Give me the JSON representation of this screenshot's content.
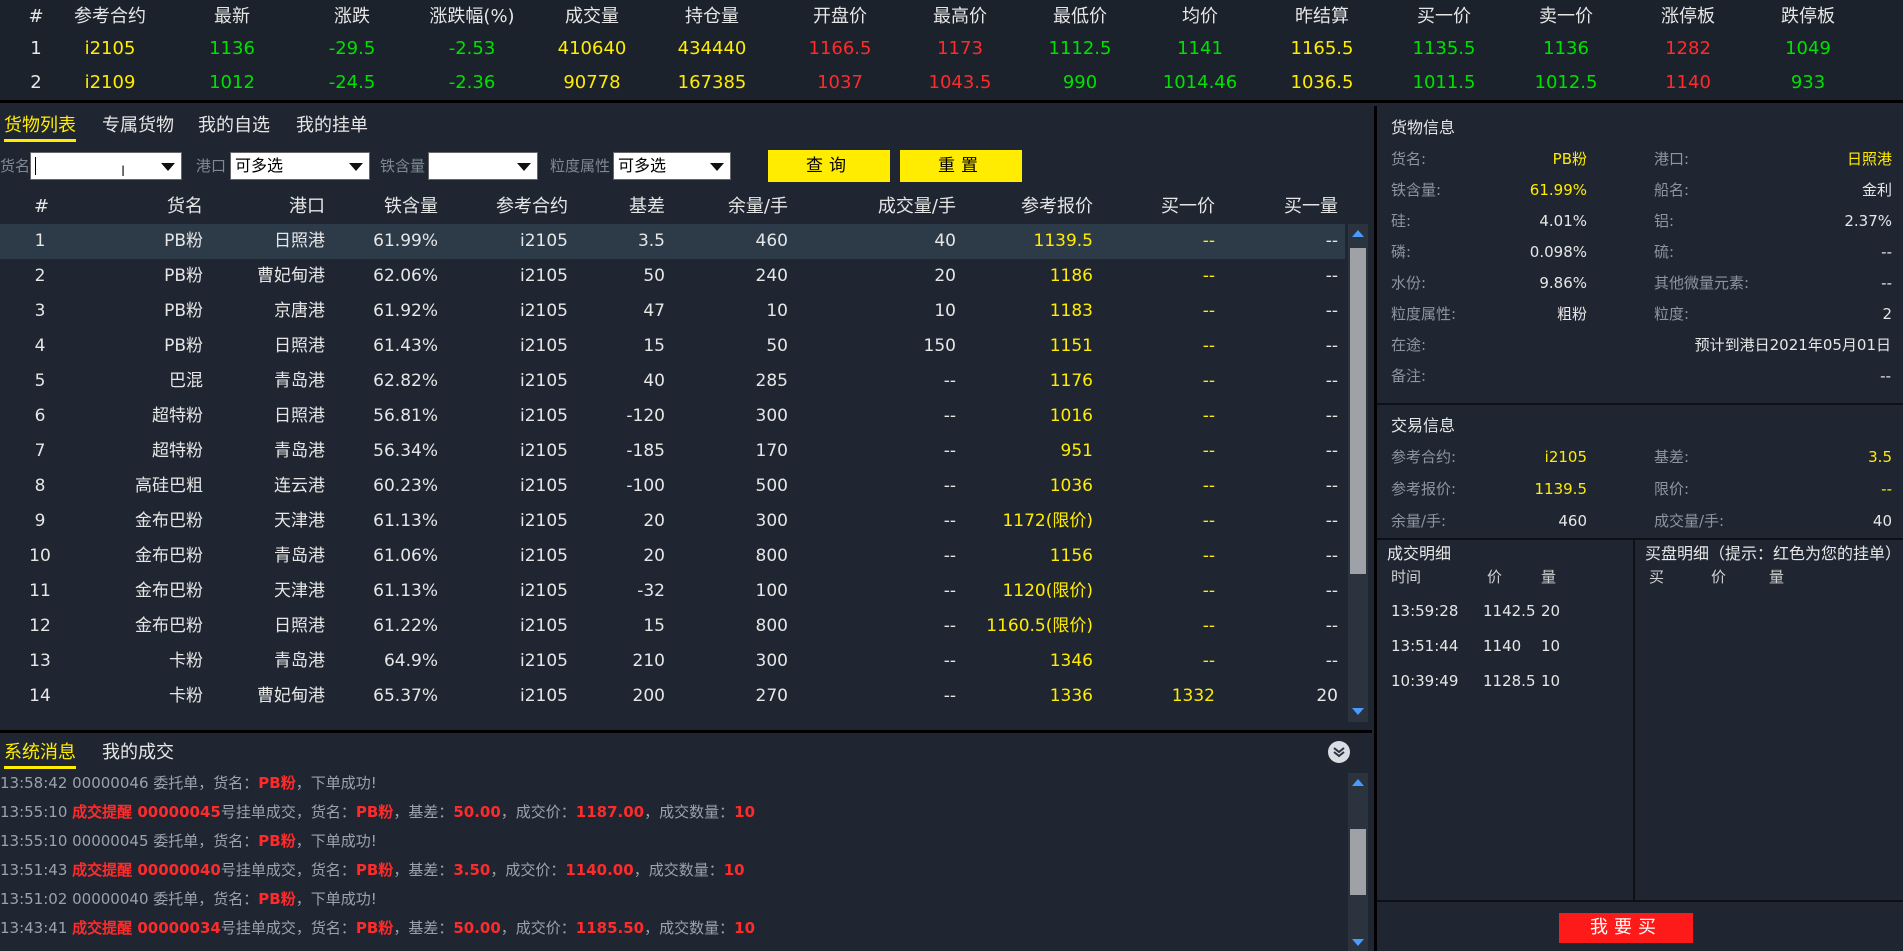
{
  "quotes": {
    "headers": [
      "#",
      "参考合约",
      "最新",
      "涨跌",
      "涨跌幅(%)",
      "成交量",
      "持仓量",
      "开盘价",
      "最高价",
      "最低价",
      "均价",
      "昨结算",
      "买一价",
      "卖一价",
      "涨停板",
      "跌停板"
    ],
    "rows": [
      [
        "1",
        "i2105",
        "1136",
        "-29.5",
        "-2.53",
        "410640",
        "434440",
        "1166.5",
        "1173",
        "1112.5",
        "1141",
        "1165.5",
        "1135.5",
        "1136",
        "1282",
        "1049"
      ],
      [
        "2",
        "i2109",
        "1012",
        "-24.5",
        "-2.36",
        "90778",
        "167385",
        "1037",
        "1043.5",
        "990",
        "1014.46",
        "1036.5",
        "1011.5",
        "1012.5",
        "1140",
        "933"
      ]
    ]
  },
  "main_tabs": [
    "货物列表",
    "专属货物",
    "我的自选",
    "我的挂单"
  ],
  "filters": {
    "name_label": "货名",
    "name_value": "",
    "port_label": "港口",
    "port_value": "可多选",
    "iron_label": "铁含量",
    "iron_value": "",
    "size_label": "粒度属性",
    "size_value": "可多选",
    "query_btn": "查询",
    "reset_btn": "重置"
  },
  "goods": {
    "headers": [
      "#",
      "货名",
      "港口",
      "铁含量",
      "参考合约",
      "基差",
      "余量/手",
      "成交量/手",
      "参考报价",
      "买一价",
      "买一量"
    ],
    "rows": [
      [
        "1",
        "PB粉",
        "日照港",
        "61.99%",
        "i2105",
        "3.5",
        "460",
        "40",
        "1139.5",
        "--",
        "--"
      ],
      [
        "2",
        "PB粉",
        "曹妃甸港",
        "62.06%",
        "i2105",
        "50",
        "240",
        "20",
        "1186",
        "--",
        "--"
      ],
      [
        "3",
        "PB粉",
        "京唐港",
        "61.92%",
        "i2105",
        "47",
        "10",
        "10",
        "1183",
        "--",
        "--"
      ],
      [
        "4",
        "PB粉",
        "日照港",
        "61.43%",
        "i2105",
        "15",
        "50",
        "150",
        "1151",
        "--",
        "--"
      ],
      [
        "5",
        "巴混",
        "青岛港",
        "62.82%",
        "i2105",
        "40",
        "285",
        "--",
        "1176",
        "--",
        "--"
      ],
      [
        "6",
        "超特粉",
        "日照港",
        "56.81%",
        "i2105",
        "-120",
        "300",
        "--",
        "1016",
        "--",
        "--"
      ],
      [
        "7",
        "超特粉",
        "青岛港",
        "56.34%",
        "i2105",
        "-185",
        "170",
        "--",
        "951",
        "--",
        "--"
      ],
      [
        "8",
        "高硅巴粗",
        "连云港",
        "60.23%",
        "i2105",
        "-100",
        "500",
        "--",
        "1036",
        "--",
        "--"
      ],
      [
        "9",
        "金布巴粉",
        "天津港",
        "61.13%",
        "i2105",
        "20",
        "300",
        "--",
        "1172(限价)",
        "--",
        "--"
      ],
      [
        "10",
        "金布巴粉",
        "青岛港",
        "61.06%",
        "i2105",
        "20",
        "800",
        "--",
        "1156",
        "--",
        "--"
      ],
      [
        "11",
        "金布巴粉",
        "天津港",
        "61.13%",
        "i2105",
        "-32",
        "100",
        "--",
        "1120(限价)",
        "--",
        "--"
      ],
      [
        "12",
        "金布巴粉",
        "日照港",
        "61.22%",
        "i2105",
        "15",
        "800",
        "--",
        "1160.5(限价)",
        "--",
        "--"
      ],
      [
        "13",
        "卡粉",
        "青岛港",
        "64.9%",
        "i2105",
        "210",
        "300",
        "--",
        "1346",
        "--",
        "--"
      ],
      [
        "14",
        "卡粉",
        "曹妃甸港",
        "65.37%",
        "i2105",
        "200",
        "270",
        "--",
        "1336",
        "1332",
        "20"
      ]
    ]
  },
  "cargo_info": {
    "title": "货物信息",
    "left": [
      [
        "货名:",
        "PB粉"
      ],
      [
        "铁含量:",
        "61.99%"
      ],
      [
        "硅:",
        "4.01%"
      ],
      [
        "磷:",
        "0.098%"
      ],
      [
        "水份:",
        "9.86%"
      ],
      [
        "粒度属性:",
        "粗粉"
      ],
      [
        "在途:",
        ""
      ],
      [
        "备注:",
        ""
      ]
    ],
    "right": [
      [
        "港口:",
        "日照港"
      ],
      [
        "船名:",
        "金利"
      ],
      [
        "铝:",
        "2.37%"
      ],
      [
        "硫:",
        "--"
      ],
      [
        "其他微量元素:",
        "--"
      ],
      [
        "粒度:",
        "2"
      ]
    ],
    "transit_value": "预计到港日2021年05月01日",
    "remark_value": "--"
  },
  "trade_info": {
    "title": "交易信息",
    "left": [
      [
        "参考合约:",
        "i2105"
      ],
      [
        "参考报价:",
        "1139.5"
      ],
      [
        "余量/手:",
        "460"
      ]
    ],
    "right": [
      [
        "基差:",
        "3.5"
      ],
      [
        "限价:",
        "--"
      ],
      [
        "成交量/手:",
        "40"
      ]
    ]
  },
  "deal_detail": {
    "title": "成交明细",
    "headers": [
      "时间",
      "价",
      "量"
    ],
    "rows": [
      [
        "13:59:28",
        "1142.5",
        "20"
      ],
      [
        "13:51:44",
        "1140",
        "10"
      ],
      [
        "10:39:49",
        "1128.5",
        "10"
      ]
    ]
  },
  "buy_detail": {
    "title": "买盘明细（提示：红色为您的挂单）",
    "headers": [
      "买",
      "价",
      "量"
    ]
  },
  "buy_button": "我要买",
  "bottom_tabs": [
    "系统消息",
    "我的成交"
  ],
  "messages": [
    {
      "parts": [
        [
          "13:58:42 00000046 委托单，货名：",
          "n"
        ],
        [
          "PB粉",
          "b"
        ],
        [
          "，下单成功!",
          "n"
        ]
      ]
    },
    {
      "parts": [
        [
          "13:55:10 ",
          "n"
        ],
        [
          "成交提醒 00000045",
          "b"
        ],
        [
          "号挂单成交，货名：",
          "n"
        ],
        [
          "PB粉",
          "b"
        ],
        [
          "，基差：",
          "n"
        ],
        [
          "50.00",
          "b"
        ],
        [
          "，成交价：",
          "n"
        ],
        [
          "1187.00",
          "b"
        ],
        [
          "，成交数量：",
          "n"
        ],
        [
          "10",
          "b"
        ]
      ]
    },
    {
      "parts": [
        [
          "13:55:10 00000045 委托单，货名：",
          "n"
        ],
        [
          "PB粉",
          "b"
        ],
        [
          "，下单成功!",
          "n"
        ]
      ]
    },
    {
      "parts": [
        [
          "13:51:43 ",
          "n"
        ],
        [
          "成交提醒 00000040",
          "b"
        ],
        [
          "号挂单成交，货名：",
          "n"
        ],
        [
          "PB粉",
          "b"
        ],
        [
          "，基差：",
          "n"
        ],
        [
          "3.50",
          "b"
        ],
        [
          "，成交价：",
          "n"
        ],
        [
          "1140.00",
          "b"
        ],
        [
          "，成交数量：",
          "n"
        ],
        [
          "10",
          "b"
        ]
      ]
    },
    {
      "parts": [
        [
          "13:51:02 00000040 委托单，货名：",
          "n"
        ],
        [
          "PB粉",
          "b"
        ],
        [
          "，下单成功!",
          "n"
        ]
      ]
    },
    {
      "parts": [
        [
          "13:43:41 ",
          "n"
        ],
        [
          "成交提醒 00000034",
          "b"
        ],
        [
          "号挂单成交，货名：",
          "n"
        ],
        [
          "PB粉",
          "b"
        ],
        [
          "，基差：",
          "n"
        ],
        [
          "50.00",
          "b"
        ],
        [
          "，成交价：",
          "n"
        ],
        [
          "1185.50",
          "b"
        ],
        [
          "，成交数量：",
          "n"
        ],
        [
          "10",
          "b"
        ]
      ]
    }
  ],
  "colors": {
    "accent": "#ffec00",
    "up": "#ff2a2a",
    "down": "#00e000",
    "bg": "#1f2631"
  }
}
